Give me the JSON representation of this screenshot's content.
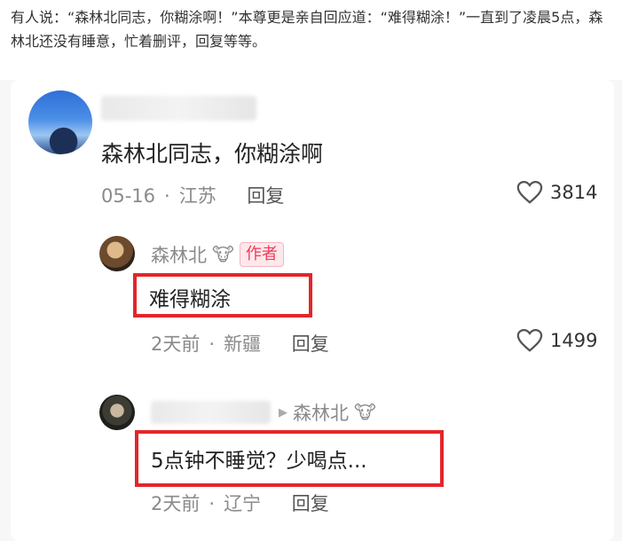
{
  "caption": "有人说：“森林北同志，你糊涂啊！”本尊更是亲自回应道：“难得糊涂！”一直到了凌晨5点，森林北还没有睡意，忙着删评，回复等等。",
  "comments": {
    "main": {
      "text": "森林北同志，你糊涂啊",
      "date": "05-16",
      "location": "江苏",
      "reply_label": "回复",
      "likes": "3814"
    },
    "reply1": {
      "author": "森林北",
      "author_emoji": "🐮",
      "badge": "作者",
      "text": "难得糊涂",
      "date": "2天前",
      "location": "新疆",
      "reply_label": "回复",
      "likes": "1499"
    },
    "reply2": {
      "arrow": "▶",
      "target": "森林北",
      "target_emoji": "🐮",
      "text": "5点钟不睡觉？少喝点...",
      "date": "2天前",
      "location": "辽宁",
      "reply_label": "回复"
    }
  },
  "separator": "·",
  "icons": {
    "like": "heart-outline-icon"
  },
  "colors": {
    "highlight": "#e3262b",
    "badge_text": "#f03b5a"
  }
}
